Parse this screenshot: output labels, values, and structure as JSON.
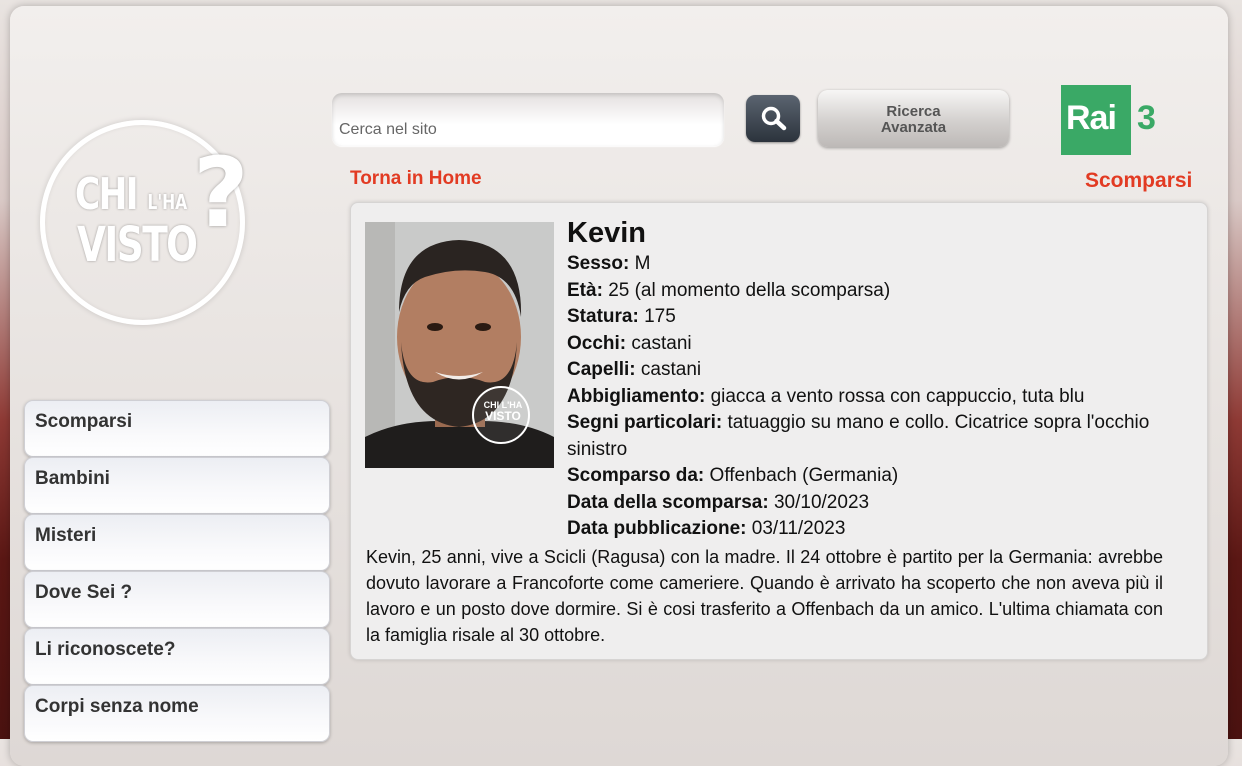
{
  "brand": {
    "logo_line1": "CHI",
    "logo_small": "L'HA",
    "logo_line2": "VISTO",
    "logo_mark": "?",
    "channel": "Rai",
    "channel_number": "3",
    "channel_color": "#3aa966"
  },
  "search": {
    "placeholder": "Cerca nel sito",
    "value": "",
    "button_icon": "search-icon",
    "advanced_line1": "Ricerca",
    "advanced_line2": "Avanzata"
  },
  "nav": {
    "home_link": "Torna in Home",
    "section_title": "Scomparsi"
  },
  "accent_color": "#e23b23",
  "profile": {
    "name": "Kevin",
    "photo_watermark_line1": "CHI L'HA",
    "photo_watermark_line2": "VISTO",
    "fields": [
      {
        "label": "Sesso:",
        "value": "M"
      },
      {
        "label": "Età:",
        "value": "25 (al momento della scomparsa)"
      },
      {
        "label": "Statura:",
        "value": "175"
      },
      {
        "label": "Occhi:",
        "value": "castani"
      },
      {
        "label": "Capelli:",
        "value": "castani"
      },
      {
        "label": "Abbigliamento:",
        "value": "giacca a vento rossa con cappuccio, tuta blu"
      },
      {
        "label": "Segni particolari:",
        "value": "tatuaggio su mano e collo. Cicatrice sopra l'occhio sinistro"
      },
      {
        "label": "Scomparso da:",
        "value": "Offenbach (Germania)"
      },
      {
        "label": "Data della scomparsa:",
        "value": "30/10/2023"
      },
      {
        "label": "Data pubblicazione:",
        "value": "03/11/2023"
      }
    ],
    "description": "Kevin, 25 anni, vive a Scicli (Ragusa) con la madre. Il 24 ottobre è partito per la Germania: avrebbe dovuto lavorare a Francoforte come cameriere. Quando è arrivato ha scoperto che non aveva più il lavoro e un posto dove dormire. Si è cosi  trasferito a Offenbach da un amico. L'ultima chiamata con la famiglia risale al 30 ottobre."
  },
  "menu": {
    "items": [
      {
        "label": "Scomparsi"
      },
      {
        "label": "Bambini"
      },
      {
        "label": "Misteri"
      },
      {
        "label": "Dove Sei ?"
      },
      {
        "label": "Li riconoscete?"
      },
      {
        "label": "Corpi senza nome"
      }
    ]
  }
}
